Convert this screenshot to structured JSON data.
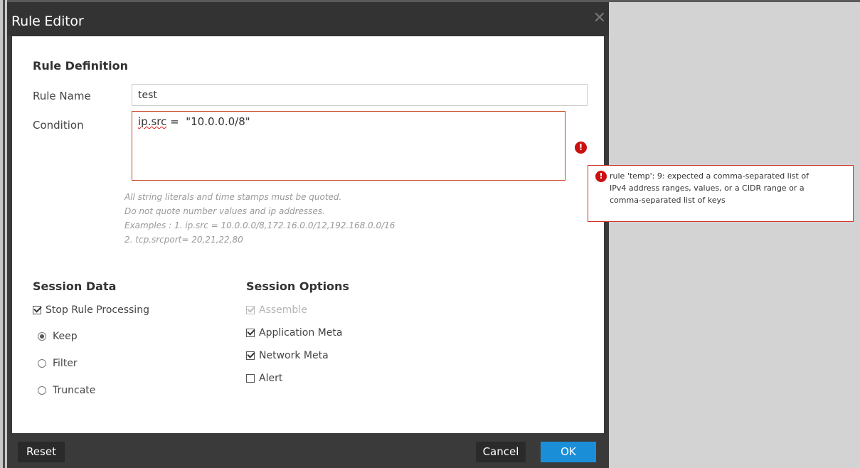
{
  "dialog": {
    "title": "Rule Editor",
    "close_glyph": "✕"
  },
  "rule_definition": {
    "heading": "Rule Definition",
    "rule_name_label": "Rule Name",
    "rule_name_value": "test",
    "condition_label": "Condition",
    "condition_value_prefix": "ip.src",
    "condition_value_rest": " =  \"10.0.0.0/8\"",
    "hints": [
      "All string literals and time stamps must be quoted.",
      "Do not quote number values and ip addresses.",
      "Examples : 1. ip.src = 10.0.0.0/8,172.16.0.0/12,192.168.0.0/16",
      "2. tcp.srcport= 20,21,22,80"
    ]
  },
  "error": {
    "icon_glyph": "!",
    "color": "#cc1010",
    "lines": [
      "rule 'temp': 9: expected a comma-separated list of",
      "IPv4 address ranges, values, or a CIDR range or a",
      "comma-separated list of keys"
    ]
  },
  "session_data": {
    "heading": "Session Data",
    "stop_rule_processing": {
      "label": "Stop Rule Processing",
      "checked": true
    },
    "radios": [
      {
        "label": "Keep",
        "selected": true
      },
      {
        "label": "Filter",
        "selected": false
      },
      {
        "label": "Truncate",
        "selected": false
      }
    ]
  },
  "session_options": {
    "heading": "Session Options",
    "options": [
      {
        "label": "Assemble",
        "checked": true,
        "disabled": true
      },
      {
        "label": "Application Meta",
        "checked": true,
        "disabled": false
      },
      {
        "label": "Network Meta",
        "checked": true,
        "disabled": false
      },
      {
        "label": "Alert",
        "checked": false,
        "disabled": false
      }
    ]
  },
  "footer": {
    "reset_label": "Reset",
    "cancel_label": "Cancel",
    "ok_label": "OK",
    "ok_color": "#1a8fd8"
  }
}
